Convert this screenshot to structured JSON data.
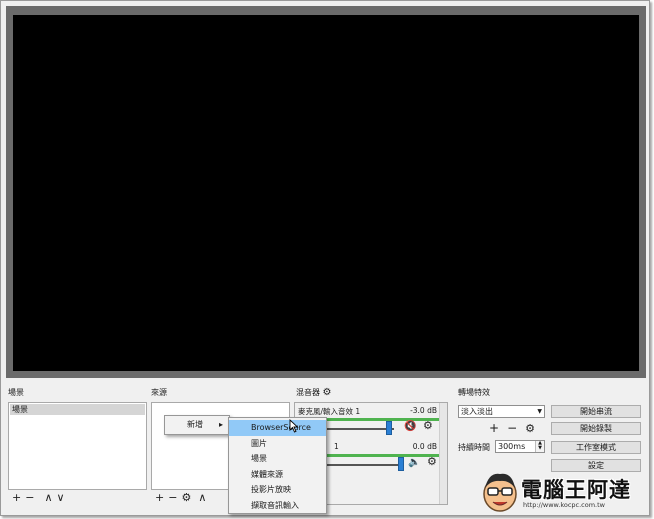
{
  "preview": {},
  "docks": {
    "scenes": {
      "title": "場景",
      "items": [
        "場景"
      ]
    },
    "sources": {
      "title": "來源"
    },
    "mixer": {
      "title": "混音器",
      "tracks": [
        {
          "name": "麥克風/輸入音效 1",
          "db": "-3.0 dB"
        },
        {
          "name": "1",
          "db": "0.0 dB"
        }
      ]
    },
    "transitions": {
      "title": "轉場特效",
      "selected": "淡入淡出",
      "duration_label": "持續時間",
      "duration_value": "300ms"
    }
  },
  "toolbar": {
    "add": "+",
    "remove": "−",
    "up": "∧",
    "down": "∨",
    "gear": "⚙"
  },
  "controls": [
    "開始串流",
    "開始錄製",
    "工作室模式",
    "設定"
  ],
  "context_menu": {
    "add_label": "新增",
    "submenu_arrow": "▸",
    "items": [
      "BrowserSource",
      "圖片",
      "場景",
      "媒體來源",
      "投影片放映",
      "擷取音訊輸入"
    ]
  },
  "watermark": {
    "title": "電腦王阿達",
    "url": "http://www.kocpc.com.tw"
  },
  "colors": {
    "preview_bg": "#000000",
    "preview_frame": "#6b6b6b",
    "menu_highlight": "#91c9f7",
    "meter_green": "#4fb34f",
    "slider_blue": "#2a7fd4",
    "mute_red": "#d10000"
  }
}
